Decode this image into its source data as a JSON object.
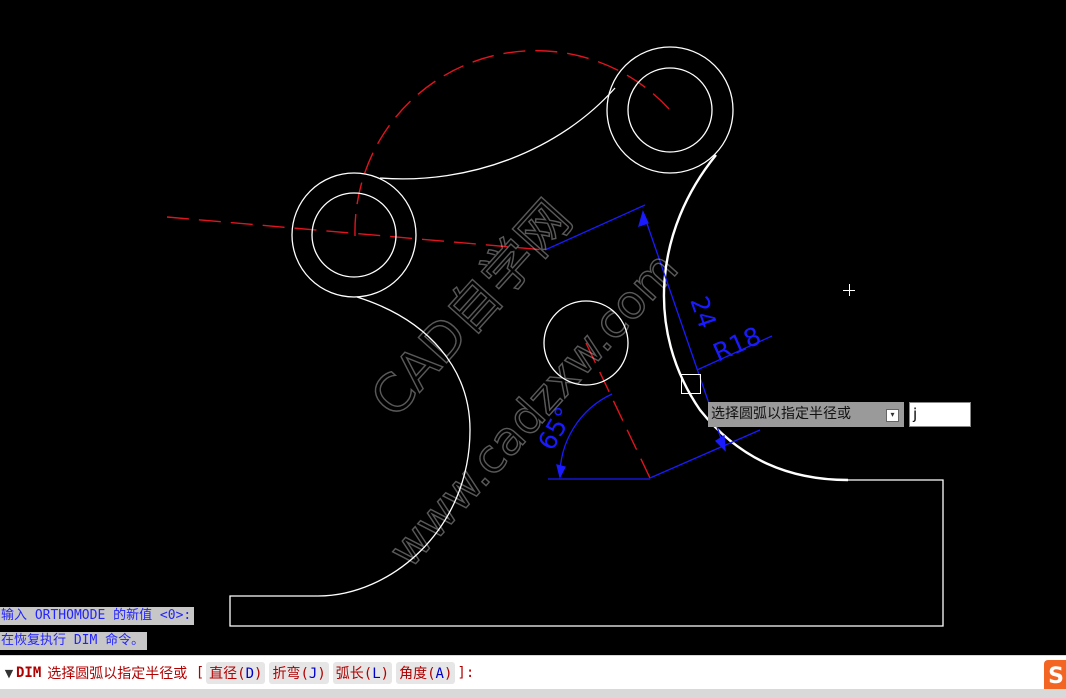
{
  "drawing": {
    "dimensions": {
      "linear": "24",
      "radius": "R18",
      "angle": "65°"
    },
    "colors": {
      "background": "#000000",
      "geometry": "#ffffff",
      "centerline": "#e0141e",
      "dimension": "#1a1aff",
      "highlight": "#ffffff"
    }
  },
  "watermark": {
    "line1": "CAD自学网",
    "line2": "www.cadzxw.com"
  },
  "tooltip": {
    "text": "选择圆弧以指定半径或",
    "icon": "expand-down-icon"
  },
  "dynamic_input": {
    "value": "j"
  },
  "history": {
    "line1": "输入 ORTHOMODE 的新值 <0>:",
    "line2": "在恢复执行 DIM 命令。"
  },
  "command_line": {
    "arrow": "▼",
    "command": "DIM",
    "prompt": "选择圆弧以指定半径或",
    "open_bracket": " [",
    "options": [
      {
        "pre": "直径(",
        "key": "D",
        "post": ")"
      },
      {
        "pre": "折弯(",
        "key": "J",
        "post": ")"
      },
      {
        "pre": "弧长(",
        "key": "L",
        "post": ")"
      },
      {
        "pre": "角度(",
        "key": "A",
        "post": ")"
      }
    ],
    "close_bracket": "]:"
  },
  "app_logo": {
    "text": "S",
    "color": "#f26522"
  }
}
